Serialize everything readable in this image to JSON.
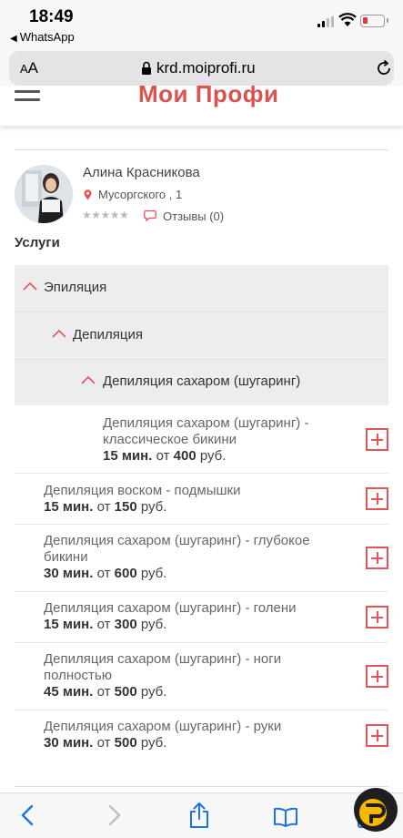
{
  "status_bar": {
    "time": "18:49",
    "back_app": "WhatsApp"
  },
  "browser": {
    "text_size": "AA",
    "url": "krd.moiprofi.ru"
  },
  "site": {
    "logo": "Мои Профи"
  },
  "profile": {
    "name": "Алина Красникова",
    "address": "Мусоргского , 1",
    "rating_stars": 5,
    "reviews": "Отзывы (0)"
  },
  "services_title": "Услуги",
  "accordion": {
    "level1": "Эпиляция",
    "level2": "Депиляция",
    "level3": "Депиляция сахаром (шугаринг)"
  },
  "items": [
    {
      "name_lines": [
        "Депиляция сахаром (шугаринг) -",
        "классическое бикини"
      ],
      "duration": "15 мин.",
      "from": "от",
      "price": "400",
      "currency": "руб."
    },
    {
      "name_lines": [
        "Депиляция воском - подмышки"
      ],
      "duration": "15 мин.",
      "from": "от",
      "price": "150",
      "currency": "руб."
    },
    {
      "name_lines": [
        "Депиляция сахаром (шугаринг) - глубокое",
        "бикини"
      ],
      "duration": "30 мин.",
      "from": "от",
      "price": "600",
      "currency": "руб."
    },
    {
      "name_lines": [
        "Депиляция сахаром (шугаринг) - голени"
      ],
      "duration": "15 мин.",
      "from": "от",
      "price": "300",
      "currency": "руб."
    },
    {
      "name_lines": [
        "Депиляция сахаром (шугаринг) - ноги",
        "полностью"
      ],
      "duration": "45 мин.",
      "from": "от",
      "price": "500",
      "currency": "руб."
    },
    {
      "name_lines": [
        "Депиляция сахаром (шугаринг) - руки"
      ],
      "duration": "30 мин.",
      "from": "от",
      "price": "500",
      "currency": "руб."
    }
  ],
  "colors": {
    "accent": "#e35656",
    "accordion_bg": "#ededed",
    "ios_blue": "#1a73e8"
  },
  "icons": [
    "back-arrow-icon",
    "forward-arrow-icon",
    "share-icon",
    "bookmarks-icon",
    "tabs-icon",
    "reload-icon",
    "lock-icon"
  ]
}
